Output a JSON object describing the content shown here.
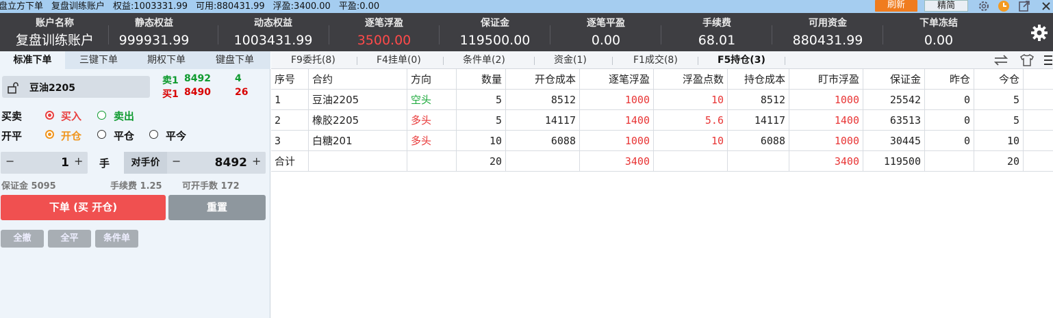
{
  "titlebar": {
    "app_name": "盘立方下单",
    "account": "复盘训练账户",
    "equity": "权益:1003331.99",
    "available": "可用:880431.99",
    "floating": "浮盈:3400.00",
    "closed_pnl": "平盈:0.00",
    "refresh_label": "刷新",
    "simple_label": "精简",
    "icons": [
      "gear-icon",
      "clock-icon",
      "export-icon",
      "close-icon"
    ]
  },
  "account_header": {
    "columns": [
      {
        "label": "账户名称",
        "value": "复盘训练账户"
      },
      {
        "label": "静态权益",
        "value": "999931.99"
      },
      {
        "label": "动态权益",
        "value": "1003431.99"
      },
      {
        "label": "逐笔浮盈",
        "value": "3500.00"
      },
      {
        "label": "保证金",
        "value": "119500.00"
      },
      {
        "label": "逐笔平盈",
        "value": "0.00"
      },
      {
        "label": "手续费",
        "value": "68.01"
      },
      {
        "label": "可用资金",
        "value": "880431.99"
      },
      {
        "label": "下单冻结",
        "value": "0.00"
      }
    ]
  },
  "left_tabs": [
    "标准下单",
    "三键下单",
    "期权下单",
    "键盘下单"
  ],
  "order_form": {
    "contract": "豆油2205",
    "quotes": {
      "sell_label": "卖1",
      "sell_price": "8492",
      "sell_qty": "4",
      "buy_label": "买1",
      "buy_price": "8490",
      "buy_qty": "26"
    },
    "direction_label": "买卖",
    "buy_option": "买入",
    "sell_option": "卖出",
    "offset_label": "开平",
    "open_option": "开仓",
    "close_option": "平仓",
    "close_today_option": "平今",
    "qty_minus": "−",
    "qty_value": "1",
    "qty_plus": "+",
    "qty_unit": "手",
    "price_type": "对手价",
    "price_minus": "−",
    "price_value": "8492",
    "price_plus": "+",
    "margin_info": "保证金 5095",
    "fee_info": "手续费 1.25",
    "openable_info": "可开手数 172",
    "submit_label": "下单 (买 开仓)",
    "reset_label": "重置",
    "cancel_all_label": "全撤",
    "close_all_label": "全平",
    "conditional_label": "条件单"
  },
  "right_tabs": [
    {
      "label": "F9委托(8)"
    },
    {
      "label": "F4挂单(0)"
    },
    {
      "label": "条件单(2)"
    },
    {
      "label": "资金(1)"
    },
    {
      "label": "F1成交(8)"
    },
    {
      "label": "F5持仓(3)"
    }
  ],
  "positions": {
    "headers": [
      "序号",
      "合约",
      "方向",
      "数量",
      "开仓成本",
      "逐笔浮盈",
      "浮盈点数",
      "持仓成本",
      "盯市浮盈",
      "保证金",
      "昨仓",
      "今仓"
    ],
    "rows": [
      [
        "1",
        "豆油2205",
        "空头",
        "5",
        "8512",
        "1000",
        "10",
        "8512",
        "1000",
        "25542",
        "0",
        "5"
      ],
      [
        "2",
        "橡胶2205",
        "多头",
        "5",
        "14117",
        "1400",
        "5.6",
        "14117",
        "1400",
        "63513",
        "0",
        "5"
      ],
      [
        "3",
        "白糖201",
        "多头",
        "10",
        "6088",
        "1000",
        "10",
        "6088",
        "1000",
        "30445",
        "0",
        "10"
      ]
    ],
    "total": [
      "合计",
      "",
      "",
      "20",
      "",
      "3400",
      "",
      "",
      "3400",
      "119500",
      "",
      "20"
    ]
  }
}
